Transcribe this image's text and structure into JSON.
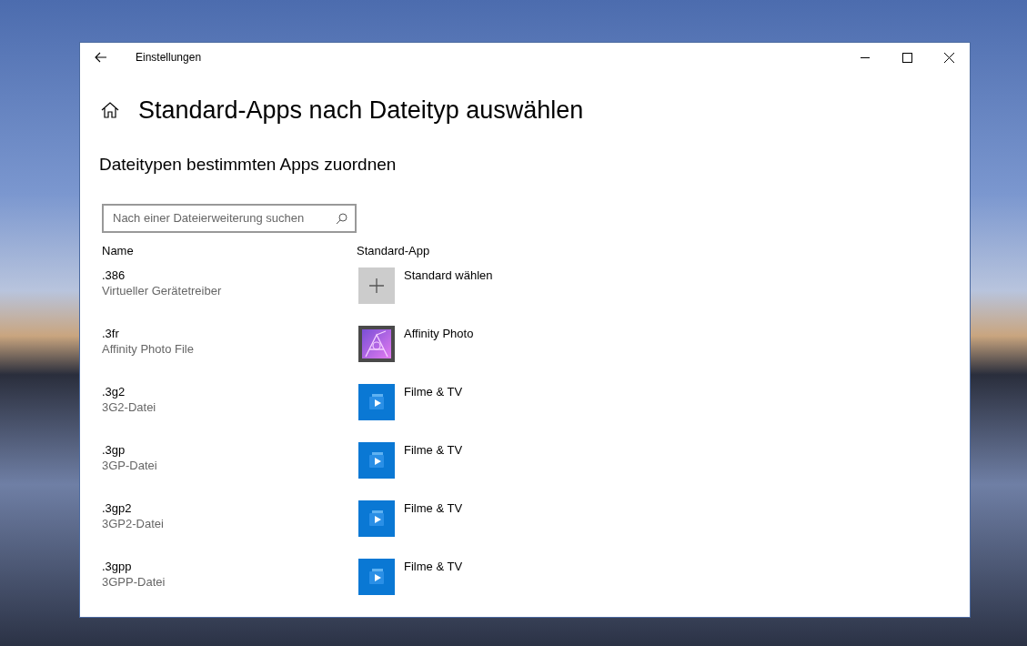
{
  "window": {
    "title": "Einstellungen"
  },
  "page_title": "Standard-Apps nach Dateityp auswählen",
  "section_title": "Dateitypen bestimmten Apps zuordnen",
  "search": {
    "placeholder": "Nach einer Dateierweiterung suchen"
  },
  "columns": [
    "Name",
    "Standard-App"
  ],
  "rows": [
    {
      "extension": ".386",
      "description": "Virtueller Gerätetreiber",
      "app": {
        "kind": "add",
        "name": "Standard wählen"
      }
    },
    {
      "extension": ".3fr",
      "description": "Affinity Photo File",
      "app": {
        "kind": "affinity",
        "name": "Affinity Photo"
      }
    },
    {
      "extension": ".3g2",
      "description": "3G2-Datei",
      "app": {
        "kind": "films",
        "name": "Filme & TV"
      }
    },
    {
      "extension": ".3gp",
      "description": "3GP-Datei",
      "app": {
        "kind": "films",
        "name": "Filme & TV"
      }
    },
    {
      "extension": ".3gp2",
      "description": "3GP2-Datei",
      "app": {
        "kind": "films",
        "name": "Filme & TV"
      }
    },
    {
      "extension": ".3gpp",
      "description": "3GPP-Datei",
      "app": {
        "kind": "films",
        "name": "Filme & TV"
      }
    }
  ]
}
